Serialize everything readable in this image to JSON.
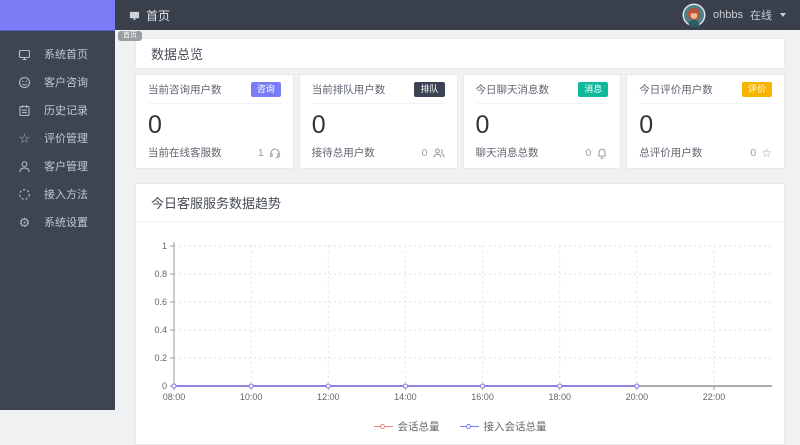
{
  "header": {
    "breadcrumb": "首页",
    "username": "ohbbs",
    "status": "在线"
  },
  "page_tag": "首页",
  "sidebar": {
    "items": [
      {
        "label": "系统首页",
        "icon": "monitor-icon"
      },
      {
        "label": "客户咨询",
        "icon": "chat-smile-icon"
      },
      {
        "label": "历史记录",
        "icon": "notebook-icon"
      },
      {
        "label": "评价管理",
        "icon": "star-icon"
      },
      {
        "label": "客户管理",
        "icon": "user-icon"
      },
      {
        "label": "接入方法",
        "icon": "spinner-icon"
      },
      {
        "label": "系统设置",
        "icon": "gear-icon"
      }
    ]
  },
  "overview": {
    "title": "数据总览",
    "cards": [
      {
        "title": "当前咨询用户数",
        "badge": "咨询",
        "badge_color": "#7b7df7",
        "value": "0",
        "footer_label": "当前在线客服数",
        "footer_value": "1",
        "footer_icon": "headset-icon"
      },
      {
        "title": "当前排队用户数",
        "badge": "排队",
        "badge_color": "#3c4354",
        "value": "0",
        "footer_label": "接待总用户数",
        "footer_value": "0",
        "footer_icon": "users-icon"
      },
      {
        "title": "今日聊天消息数",
        "badge": "消息",
        "badge_color": "#0fb99c",
        "value": "0",
        "footer_label": "聊天消息总数",
        "footer_value": "0",
        "footer_icon": "bell-icon"
      },
      {
        "title": "今日评价用户数",
        "badge": "评价",
        "badge_color": "#f5b400",
        "value": "0",
        "footer_label": "总评价用户数",
        "footer_value": "0",
        "footer_icon": "star-icon"
      }
    ]
  },
  "chart_panel": {
    "title": "今日客服服务数据趋势"
  },
  "chart_data": {
    "type": "line",
    "title": "今日客服服务数据趋势",
    "x_ticks": [
      "08:00",
      "10:00",
      "12:00",
      "14:00",
      "16:00",
      "18:00",
      "20:00",
      "22:00"
    ],
    "y_ticks": [
      0,
      0.2,
      0.4,
      0.6,
      0.8,
      1
    ],
    "ylim": [
      0,
      1
    ],
    "grid": "dotted",
    "legend_position": "bottom",
    "series": [
      {
        "name": "会话总量",
        "color": "#e58585",
        "x": [
          "08:00",
          "10:00",
          "12:00",
          "14:00",
          "16:00",
          "18:00",
          "20:00"
        ],
        "values": [
          0,
          0,
          0,
          0,
          0,
          0,
          0
        ]
      },
      {
        "name": "接入会话总量",
        "color": "#7b7ef8",
        "x": [
          "08:00",
          "10:00",
          "12:00",
          "14:00",
          "16:00",
          "18:00",
          "20:00"
        ],
        "values": [
          0,
          0,
          0,
          0,
          0,
          0,
          0
        ]
      }
    ]
  }
}
